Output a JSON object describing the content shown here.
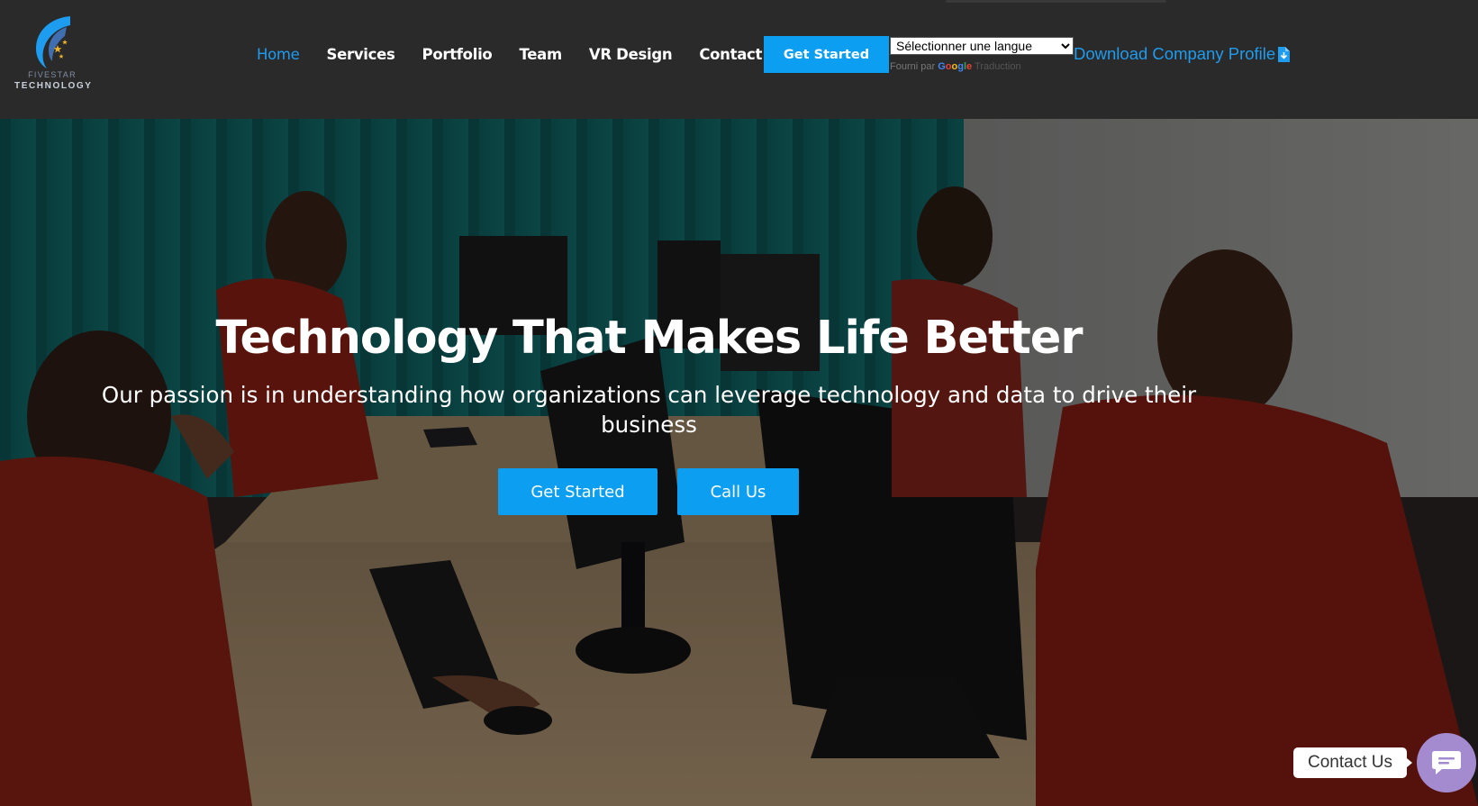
{
  "logo": {
    "line1": "FIVESTAR",
    "line2": "TECHNOLOGY"
  },
  "nav": {
    "items": [
      {
        "label": "Home",
        "active": true
      },
      {
        "label": "Services"
      },
      {
        "label": "Portfolio"
      },
      {
        "label": "Team"
      },
      {
        "label": "VR Design"
      },
      {
        "label": "Contact"
      }
    ]
  },
  "header": {
    "cta_label": "Get Started",
    "language_select": {
      "selected": "Sélectionner une langue"
    },
    "powered_by": {
      "prefix": "Fourni par",
      "brand": "Google",
      "suffix": "Traduction"
    },
    "download_label": "Download Company Profile",
    "download_icon": "file-download-icon"
  },
  "hero": {
    "title": "Technology That Makes Life Better",
    "subtitle": "Our passion is in understanding how organizations can leverage technology and data to drive their business",
    "primary_button": "Get Started",
    "secondary_button": "Call Us"
  },
  "contact_widget": {
    "label": "Contact Us",
    "icon": "chat-bubble-icon"
  },
  "colors": {
    "header_bg": "#2b2a2a",
    "accent": "#0c9ef1",
    "link": "#1e9cf0",
    "widget": "#a48bd0"
  }
}
